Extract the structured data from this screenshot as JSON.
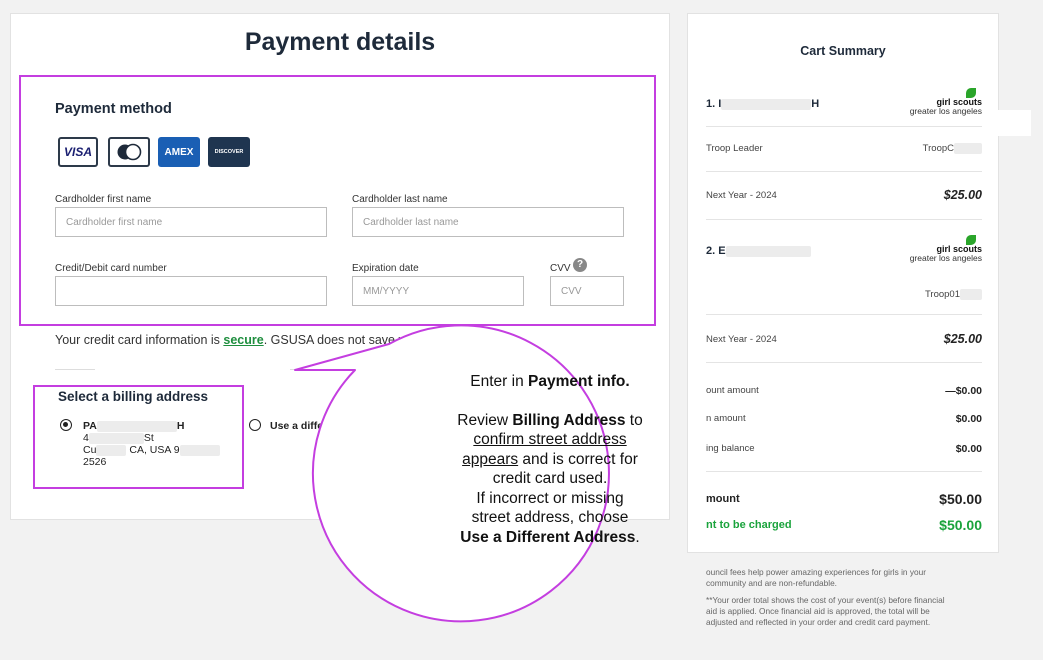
{
  "payment": {
    "title": "Payment details",
    "method_heading": "Payment method",
    "cards": [
      {
        "label": "VISA",
        "icon": "visa-card-icon"
      },
      {
        "label": "",
        "icon": "mastercard-icon"
      },
      {
        "label": "AMEX",
        "icon": "amex-card-icon"
      },
      {
        "label": "DISCOVER",
        "icon": "discover-card-icon"
      }
    ],
    "first_name_label": "Cardholder first name",
    "first_name_placeholder": "Cardholder first name",
    "last_name_label": "Cardholder last name",
    "last_name_placeholder": "Cardholder last name",
    "card_number_label": "Credit/Debit card number",
    "card_number_value": "",
    "expiration_label": "Expiration date",
    "expiration_placeholder": "MM/YYYY",
    "cvv_label": "CVV",
    "cvv_placeholder": "CVV",
    "secure_text_pre": "Your credit card information is ",
    "secure_link": "secure",
    "secure_text_post": ". GSUSA does not save your bill"
  },
  "billing": {
    "heading": "Select a billing address",
    "addr_line1_start": "PA",
    "addr_line1_end": "H",
    "addr_line2_start": "4",
    "addr_line2_end": "St",
    "addr_line3_start": "Cu",
    "addr_line3_end": "CA, USA 9",
    "addr_line4": "2526",
    "different_label": "Use a different addres"
  },
  "cart": {
    "title": "Cart Summary",
    "item1_name_start": "1. I",
    "item1_name_end": "H",
    "item1_role": "Troop Leader",
    "item1_troop": "TroopC",
    "item1_period": "Next Year - 2024",
    "item1_price": "$25.00",
    "item2_name_start": "2. E",
    "item2_troop": "Troop01",
    "item2_period": "Next Year - 2024",
    "item2_price": "$25.00",
    "logo_main": "girl scouts",
    "logo_sub": "greater los angeles",
    "discount_label": "ount amount",
    "discount_value": "—$0.00",
    "aid_label": "n amount",
    "aid_value": "$0.00",
    "balance_label": "ing balance",
    "balance_value": "$0.00",
    "total_label": "mount",
    "total_value": "$50.00",
    "charged_label": "nt to be charged",
    "charged_value": "$50.00",
    "footnote1": "Council fees help power amazing experiences for girls in your community and are non-refundable.",
    "footnote1_visible": "ouncil fees help power amazing experiences for girls in your",
    "footnote1_line2": "community and are non-refundable.",
    "footnote2_line1": "**Your order total shows the cost of your event(s) before financial",
    "footnote2_line2": "aid is applied. Once financial aid is approved, the total will be",
    "footnote2_line3": "adjusted and reflected in your order and credit card payment."
  },
  "callout": {
    "line1_pre": "Enter in ",
    "line1_bold": "Payment",
    "line1_post": " info.",
    "line2_pre": "Review ",
    "line2_bold": "Billing Address",
    "line2_post": " to",
    "line3_u": "confirm street address",
    "line4_u": "appears",
    "line4_post": " and is correct for",
    "line5": "credit card used.",
    "line6": "If incorrect or missing",
    "line7": "street address, choose",
    "line8_bold": "Use a Different Address",
    "line8_post": "."
  },
  "colors": {
    "highlight": "#c43ee0",
    "link_green": "#1e8e3e",
    "charged_green": "#1aa33c",
    "visa_blue": "#1a1f71",
    "amex_blue": "#1a5fb4",
    "discover_navy": "#1f3550"
  }
}
